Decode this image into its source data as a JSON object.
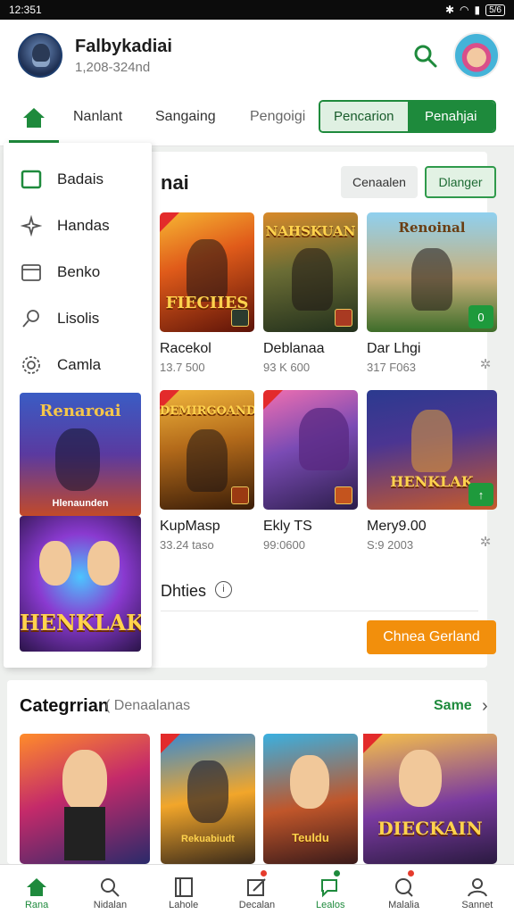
{
  "status_bar": {
    "time": "12:351",
    "battery": "5/6"
  },
  "header": {
    "title": "Falbykadiai",
    "subtitle": "1,208-324nd"
  },
  "nav": {
    "tabs": [
      "Nanlant",
      "Sangaing",
      "Pengoigi"
    ],
    "segment": [
      "Pencarion",
      "Penahjai"
    ]
  },
  "drawer": {
    "items": [
      {
        "label": "Badais",
        "icon": "square-icon"
      },
      {
        "label": "Handas",
        "icon": "star-outline-icon"
      },
      {
        "label": "Benko",
        "icon": "calendar-icon"
      },
      {
        "label": "Lisolis",
        "icon": "search-icon"
      },
      {
        "label": "Camla",
        "icon": "gear-icon"
      }
    ],
    "banners": [
      {
        "text_top": "Renaroai",
        "text_bottom": "Hlenaunden"
      },
      {
        "text": "HENKLAK"
      }
    ]
  },
  "main": {
    "title": "nai",
    "buttons": {
      "gray": "Cenaalen",
      "green": "Dlanger"
    },
    "games": [
      {
        "name": "Racekol",
        "meta": "13.7 500",
        "label": "FIECIIES",
        "art": "fire"
      },
      {
        "name": "Deblanaa",
        "meta": "93 K 600",
        "label": "NAHSKUAN",
        "art": "earth"
      },
      {
        "name": "Dar Lhgi",
        "meta": "317 F063",
        "label": "Renoinal",
        "art": "sky"
      },
      {
        "name": "KupMasp",
        "meta": "33.24 taso",
        "label": "DEMIRGOAND",
        "art": "ember"
      },
      {
        "name": "Ekly TS",
        "meta": "99:0600",
        "label": "",
        "art": "violet"
      },
      {
        "name": "Mery9.00",
        "meta": "S:9 2003",
        "label": "HENKLAK",
        "art": "night"
      }
    ],
    "subhead": "Dhties",
    "orange_button": "Chnea Gerland"
  },
  "category": {
    "title": "Categrrian",
    "subtitle": "Denaalanas",
    "see_all": "Same",
    "labels": [
      "",
      "Rekuabiudt",
      "Teuldu",
      "DIECKAIN"
    ]
  },
  "bottom_nav": [
    {
      "label": "Rana",
      "icon": "home-icon",
      "active": true
    },
    {
      "label": "Nidalan",
      "icon": "search-icon",
      "active": false
    },
    {
      "label": "Lahole",
      "icon": "book-icon",
      "active": false
    },
    {
      "label": "Decalan",
      "icon": "edit-icon",
      "active": false
    },
    {
      "label": "Lealos",
      "icon": "chat-icon",
      "active": false
    },
    {
      "label": "Malalia",
      "icon": "bubble-icon",
      "active": false
    },
    {
      "label": "Sannet",
      "icon": "user-icon",
      "active": false
    }
  ],
  "colors": {
    "primary": "#1e8a3c",
    "accent": "#f28f0c",
    "alert": "#e53b2c"
  }
}
